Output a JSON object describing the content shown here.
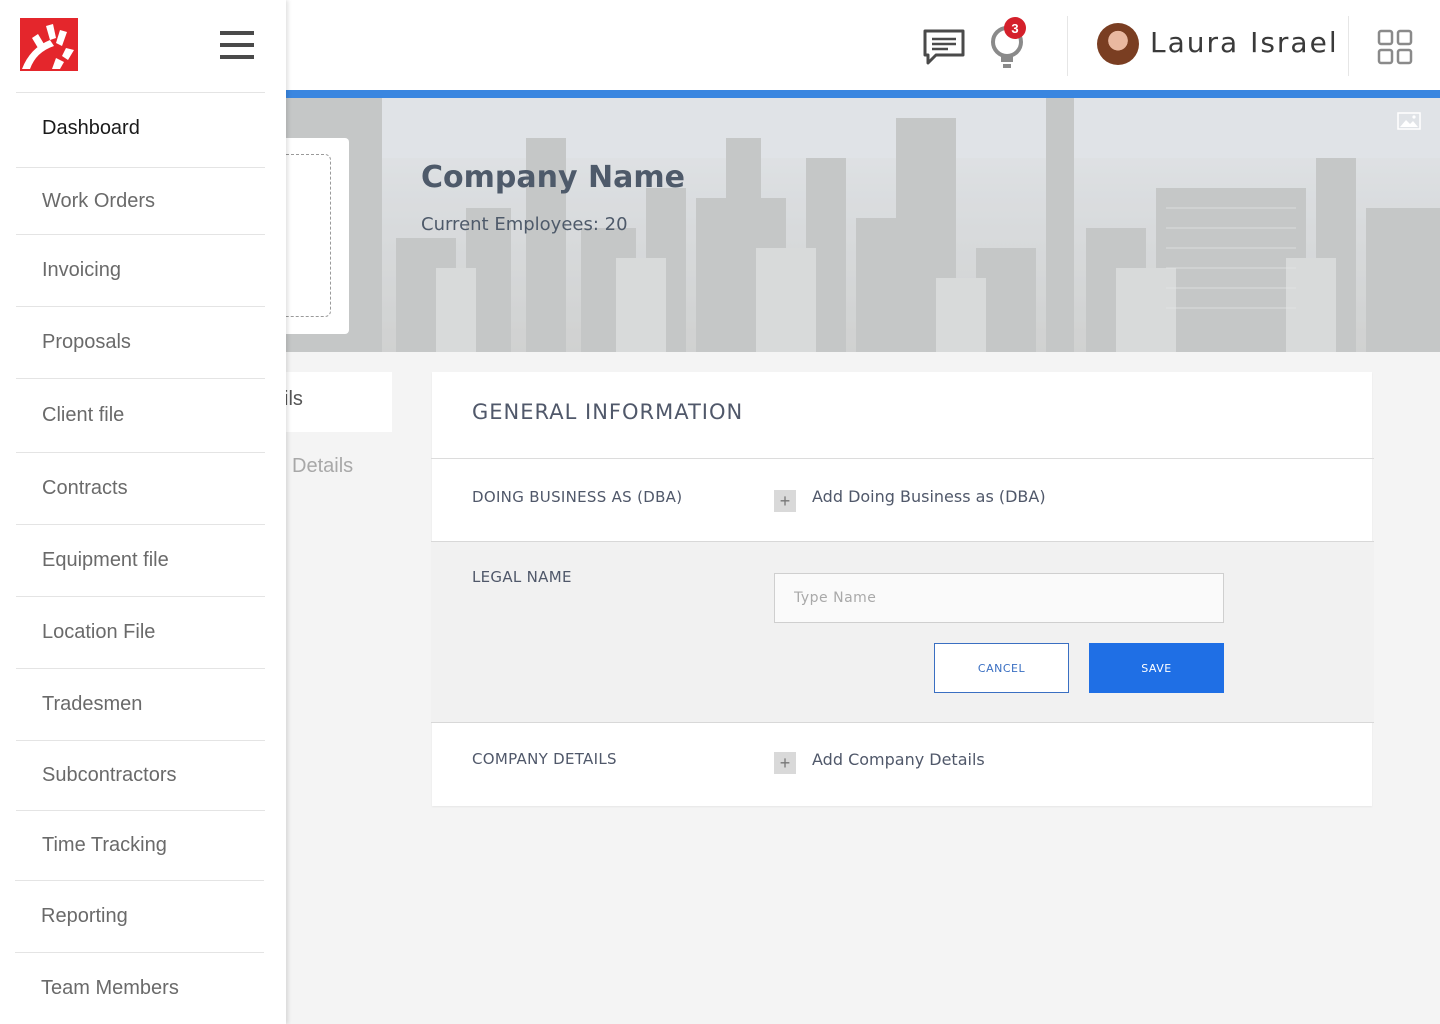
{
  "header": {
    "notification_count": "3",
    "user_name": "Laura Israel",
    "icons": [
      "chat-icon",
      "lightbulb-icon",
      "apps-grid-icon"
    ]
  },
  "banner": {
    "company_name": "Company Name",
    "employees_text": "Current Employees: 20",
    "upload_icon": "image-icon"
  },
  "tabs": {
    "active_label": "Company Details",
    "visible_active_fragment": "ils",
    "inactive_label": "Details"
  },
  "general_info": {
    "title": "GENERAL INFORMATION",
    "dba": {
      "label": "DOING BUSINESS AS (DBA)",
      "action": "Add Doing Business as (DBA)"
    },
    "legal_name": {
      "label": "LEGAL NAME",
      "placeholder": "Type Name",
      "cancel_label": "CANCEL",
      "save_label": "SAVE"
    },
    "company_details": {
      "label": "COMPANY DETAILS",
      "action": "Add Company Details"
    }
  },
  "sidebar": {
    "items": [
      {
        "label": "Dashboard"
      },
      {
        "label": "Work Orders"
      },
      {
        "label": "Invoicing"
      },
      {
        "label": "Proposals"
      },
      {
        "label": "Client file"
      },
      {
        "label": "Contracts"
      },
      {
        "label": "Equipment file"
      },
      {
        "label": "Location File"
      },
      {
        "label": "Tradesmen"
      },
      {
        "label": "Subcontractors"
      },
      {
        "label": "Time Tracking"
      },
      {
        "label": "Reporting"
      },
      {
        "label": "Team Members"
      }
    ],
    "active_index": 0
  },
  "colors": {
    "accent": "#3a86e0",
    "primary_button": "#1f6fe5",
    "badge": "#d4202b",
    "brand": "#e4262c"
  }
}
